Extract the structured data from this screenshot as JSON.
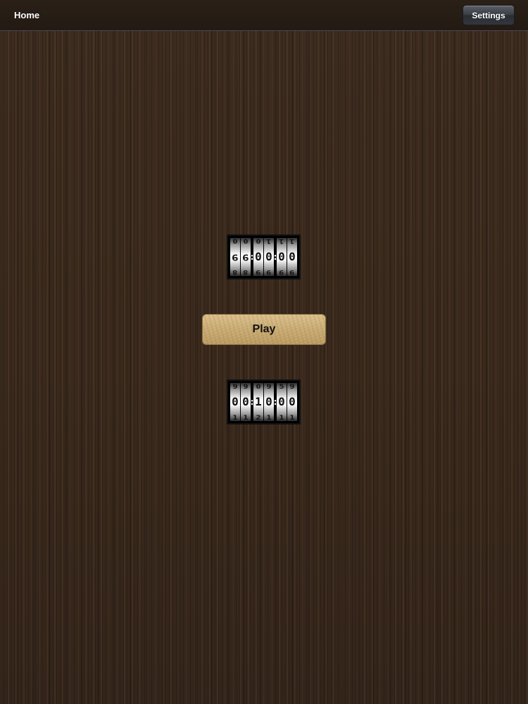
{
  "navbar": {
    "title": "Home",
    "settings_label": "Settings"
  },
  "timer_top": {
    "groups": [
      [
        {
          "above": "0",
          "current": "9",
          "below": "8"
        },
        {
          "above": "0",
          "current": "9",
          "below": "8"
        }
      ],
      [
        {
          "above": "0",
          "current": "0",
          "below": "9"
        },
        {
          "above": "1",
          "current": "0",
          "below": "9"
        }
      ],
      [
        {
          "above": "1",
          "current": "0",
          "below": "9"
        },
        {
          "above": "1",
          "current": "0",
          "below": "9"
        }
      ]
    ]
  },
  "play_button": {
    "label": "Play"
  },
  "timer_bottom": {
    "groups": [
      [
        {
          "above": "9",
          "current": "0",
          "below": "1"
        },
        {
          "above": "9",
          "current": "0",
          "below": "1"
        }
      ],
      [
        {
          "above": "0",
          "current": "1",
          "below": "2"
        },
        {
          "above": "9",
          "current": "0",
          "below": "1"
        }
      ],
      [
        {
          "above": "5",
          "current": "0",
          "below": "1"
        },
        {
          "above": "9",
          "current": "0",
          "below": "1"
        }
      ]
    ]
  }
}
